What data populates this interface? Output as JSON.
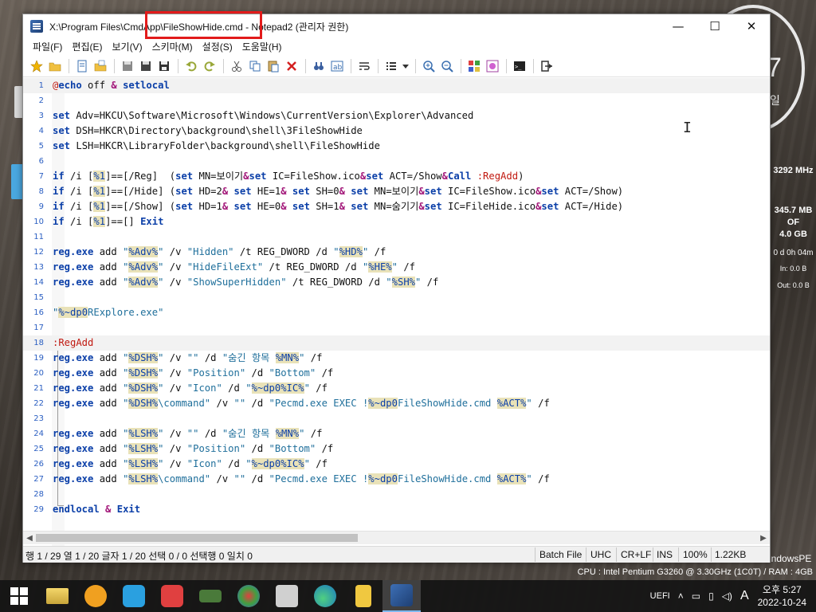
{
  "window": {
    "title": "X:\\Program Files\\CmdApp\\FileShowHide.cmd - Notepad2 (관리자 권한)",
    "minimize": "—",
    "maximize": "☐",
    "close": "✕"
  },
  "menu": [
    "파일(F)",
    "편집(E)",
    "보기(V)",
    "스키마(M)",
    "설정(S)",
    "도움말(H)"
  ],
  "statusbar": {
    "position": "행 1 / 29  열 1 / 20  글자 1 / 20  선택 0 / 0  선택행 0  일치 0",
    "lexer": "Batch File",
    "encoding": "UHC",
    "line_ending": "CR+LF",
    "ins": "INS",
    "zoom": "100%",
    "size": "1.22KB"
  },
  "desktop": {
    "clock_number": "7",
    "clock_day": "일",
    "cpu_freq": "3292 MHz",
    "mem_used": "345.7 MB",
    "mem_of": "OF",
    "mem_total": "4.0 GB",
    "uptime": "0 d 0h 04m",
    "net_in": "In: 0.0 B",
    "net_out": "Out: 0.0 B",
    "winpe": "indowsPE",
    "sysinfo": "CPU : Intel Pentium G3260 @ 3.30GHz (1C0T) / RAM : 4GB"
  },
  "tray": {
    "uefi": "UEFI",
    "ime": "A",
    "time": "오후 5:27",
    "date": "2022-10-24"
  },
  "icons": {
    "toolbar": [
      "favorite-star-icon",
      "open-folder-icon",
      "new-file-icon",
      "open-file-icon",
      "save-icon",
      "save-as-icon",
      "save-copy-icon",
      "undo-icon",
      "redo-icon",
      "cut-icon",
      "copy-icon",
      "paste-icon",
      "delete-icon",
      "find-icon",
      "replace-icon",
      "word-wrap-icon",
      "list-icon",
      "zoom-in-icon",
      "zoom-out-icon",
      "scheme-icon",
      "custom-scheme-icon",
      "console-icon",
      "exit-icon"
    ]
  }
}
